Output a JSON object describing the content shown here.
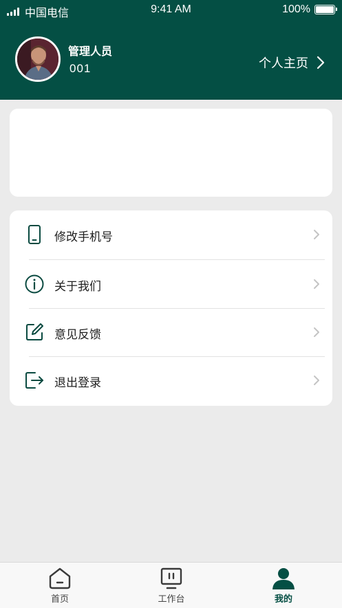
{
  "status_bar": {
    "carrier": "中国电信",
    "time": "9:41 AM",
    "battery": "100%"
  },
  "header": {
    "user_name": "管理人员",
    "user_id": "001",
    "profile_link": "个人主页",
    "bg_color": "#044f44"
  },
  "menu": {
    "items": [
      {
        "label": "修改手机号",
        "icon": "phone-icon"
      },
      {
        "label": "关于我们",
        "icon": "info-icon"
      },
      {
        "label": "意见反馈",
        "icon": "edit-icon"
      },
      {
        "label": "退出登录",
        "icon": "logout-icon"
      }
    ]
  },
  "tabbar": {
    "tabs": [
      {
        "label": "首页",
        "icon": "home-icon",
        "active": false
      },
      {
        "label": "工作台",
        "icon": "workbench-icon",
        "active": false
      },
      {
        "label": "我的",
        "icon": "user-icon",
        "active": true
      }
    ],
    "accent": "#044f44"
  }
}
